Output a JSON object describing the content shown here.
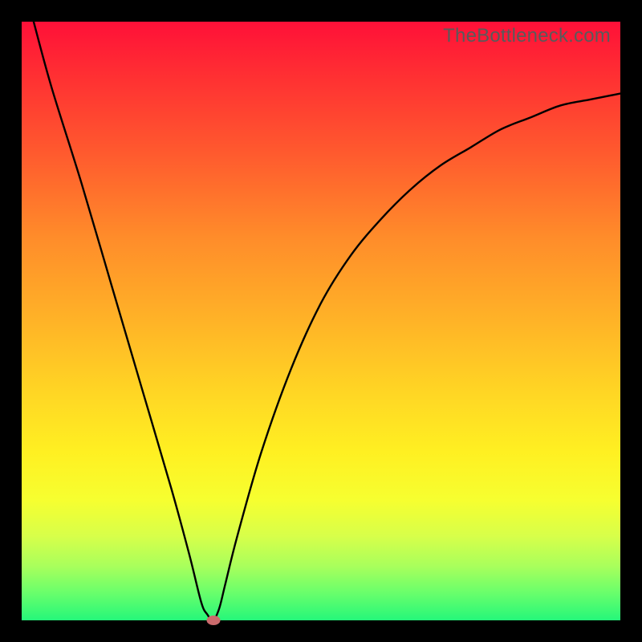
{
  "watermark": "TheBottleneck.com",
  "chart_data": {
    "type": "line",
    "title": "",
    "xlabel": "",
    "ylabel": "",
    "xlim": [
      0,
      100
    ],
    "ylim": [
      0,
      100
    ],
    "series": [
      {
        "name": "curve",
        "x": [
          2,
          5,
          10,
          15,
          20,
          25,
          28,
          30,
          31,
          32,
          33,
          34,
          36,
          40,
          45,
          50,
          55,
          60,
          65,
          70,
          75,
          80,
          85,
          90,
          95,
          100
        ],
        "values": [
          100,
          89,
          73,
          56,
          39,
          22,
          11,
          3,
          1,
          0,
          2,
          6,
          14,
          28,
          42,
          53,
          61,
          67,
          72,
          76,
          79,
          82,
          84,
          86,
          87,
          88
        ]
      }
    ],
    "marker": {
      "x": 32,
      "y": 0
    },
    "grid": false,
    "legend": false
  }
}
